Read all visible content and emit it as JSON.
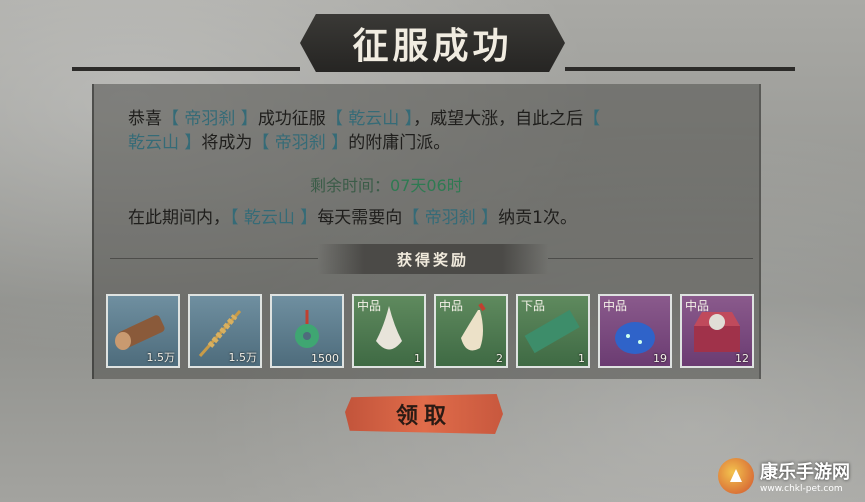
{
  "title": "征服成功",
  "message": {
    "line1": [
      {
        "t": "恭喜",
        "hl": false
      },
      {
        "t": "【 帝羽刹 】",
        "hl": true
      },
      {
        "t": "成功征服",
        "hl": false
      },
      {
        "t": "【 乾云山 】",
        "hl": true
      },
      {
        "t": "，威望大涨，自此之后",
        "hl": false
      },
      {
        "t": "【",
        "hl": true
      }
    ],
    "line2": [
      {
        "t": "乾云山 】",
        "hl": true
      },
      {
        "t": "将成为",
        "hl": false
      },
      {
        "t": "【 帝羽刹 】",
        "hl": true
      },
      {
        "t": "的附庸门派。",
        "hl": false
      }
    ]
  },
  "timer": {
    "label": "剩余时间：",
    "value": "07天06时"
  },
  "tribute": [
    {
      "t": "在此期间内，",
      "hl": false
    },
    {
      "t": "【 乾云山 】",
      "hl": true
    },
    {
      "t": "每天需要向",
      "hl": false
    },
    {
      "t": "【 帝羽刹 】",
      "hl": true
    },
    {
      "t": "纳贡1次。",
      "hl": false
    }
  ],
  "rewards_header": "获得奖励",
  "rewards": [
    {
      "icon": "wood-log-icon",
      "grade": "",
      "count": "1.5万",
      "bg": "basic"
    },
    {
      "icon": "wheat-icon",
      "grade": "",
      "count": "1.5万",
      "bg": "basic"
    },
    {
      "icon": "jade-coin-icon",
      "grade": "",
      "count": "1500",
      "bg": "basic"
    },
    {
      "icon": "white-vase-icon",
      "grade": "中品",
      "count": "1",
      "bg": "mid"
    },
    {
      "icon": "gourd-bottle-icon",
      "grade": "中品",
      "count": "2",
      "bg": "mid"
    },
    {
      "icon": "jade-brick-icon",
      "grade": "下品",
      "count": "1",
      "bg": "mid"
    },
    {
      "icon": "blue-pouch-icon",
      "grade": "中品",
      "count": "19",
      "bg": "purple"
    },
    {
      "icon": "treasure-chest-icon",
      "grade": "中品",
      "count": "12",
      "bg": "purple"
    }
  ],
  "claim_label": "领取",
  "watermark": {
    "main": "康乐手游网",
    "sub": "www.chkl-pet.com"
  },
  "colors": {
    "highlight": "#356b77",
    "timer": "#2f7a52",
    "claim": "#e06c4a"
  }
}
